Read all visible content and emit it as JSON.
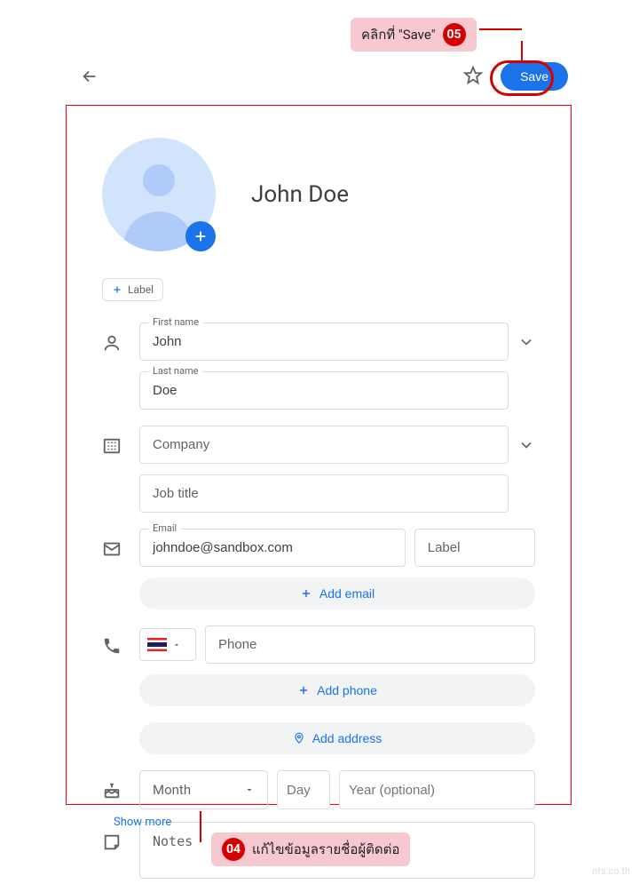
{
  "callout_top": {
    "text": "คลิกที่ \"Save\"",
    "num": "05"
  },
  "callout_bottom": {
    "num": "04",
    "text": "แก้ไขข้อมูลรายชื่อผู้ติดต่อ"
  },
  "header": {
    "save": "Save"
  },
  "contact": {
    "name": "John Doe"
  },
  "label_chip": "Label",
  "fields": {
    "first_name_label": "First name",
    "first_name_value": "John",
    "last_name_label": "Last name",
    "last_name_value": "Doe",
    "company_placeholder": "Company",
    "jobtitle_placeholder": "Job title",
    "email_label": "Email",
    "email_value": "johndoe@sandbox.com",
    "email_label_placeholder": "Label",
    "add_email": "Add email",
    "phone_placeholder": "Phone",
    "add_phone": "Add phone",
    "add_address": "Add address",
    "month_placeholder": "Month",
    "day_placeholder": "Day",
    "year_placeholder": "Year (optional)",
    "notes_placeholder": "Notes"
  },
  "show_more": "Show more",
  "watermark": "nts.co.th"
}
